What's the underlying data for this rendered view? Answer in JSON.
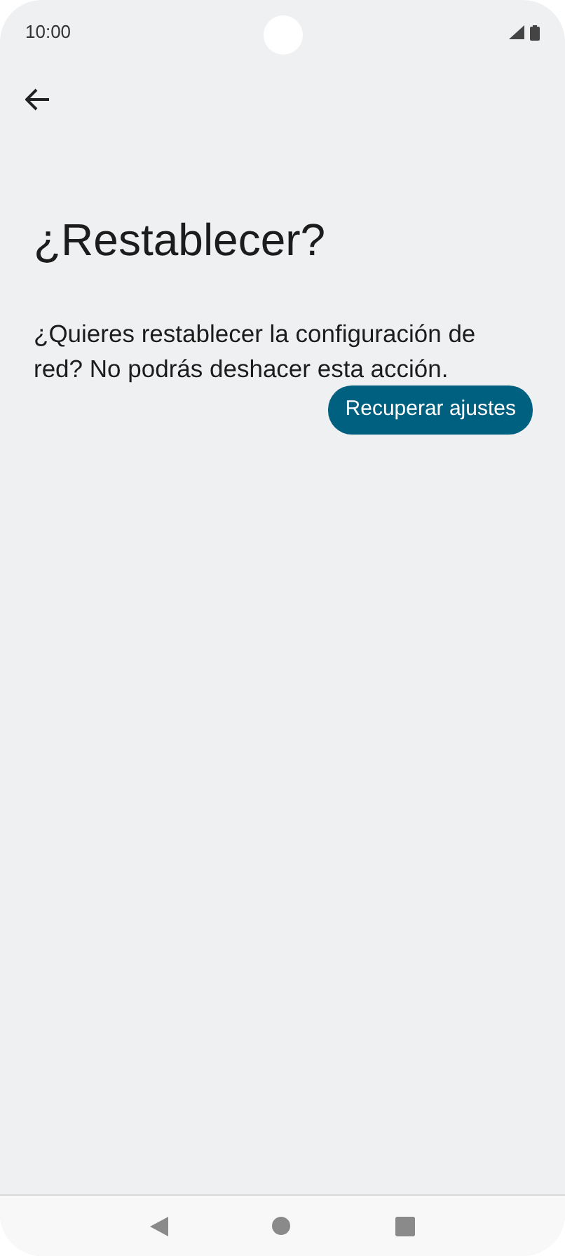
{
  "status_bar": {
    "time": "10:00"
  },
  "title": "¿Restablecer?",
  "message": "¿Quieres restablecer la configuración de red? No podrás deshacer esta acción.",
  "button": "Recuperar ajustes"
}
